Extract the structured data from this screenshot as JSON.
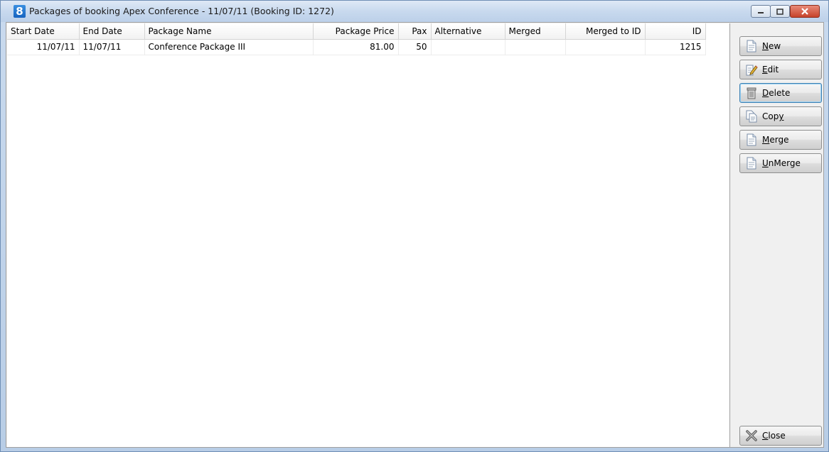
{
  "window": {
    "title": "Packages of booking Apex Conference - 11/07/11 (Booking ID: 1272)",
    "app_icon_text": "8"
  },
  "table": {
    "columns": [
      "Start Date",
      "End Date",
      "Package Name",
      "Package Price",
      "Pax",
      "Alternative",
      "Merged",
      "Merged to ID",
      "ID"
    ],
    "rows": [
      [
        "11/07/11",
        "11/07/11",
        "Conference Package III",
        "81.00",
        "50",
        "",
        "",
        "",
        "1215"
      ]
    ]
  },
  "buttons": {
    "new": {
      "mn": "N",
      "rest": "ew",
      "pre": ""
    },
    "edit": {
      "mn": "E",
      "rest": "dit",
      "pre": ""
    },
    "delete": {
      "mn": "D",
      "rest": "elete",
      "pre": ""
    },
    "copy": {
      "pre": "Cop",
      "mn": "y",
      "rest": ""
    },
    "merge": {
      "mn": "M",
      "rest": "erge",
      "pre": ""
    },
    "unmerge": {
      "mn": "U",
      "rest": "nMerge",
      "pre": ""
    },
    "close": {
      "mn": "C",
      "rest": "lose",
      "pre": ""
    }
  },
  "icons": {
    "new": "document-icon",
    "edit": "edit-pencil-icon",
    "delete": "trash-icon",
    "copy": "copy-icon",
    "merge": "merge-document-icon",
    "unmerge": "unmerge-document-icon",
    "close": "close-x-icon"
  },
  "colors": {
    "titlebar": "#c8d9ee",
    "close_button": "#c7432b",
    "focus_border": "#3c7fb1"
  }
}
